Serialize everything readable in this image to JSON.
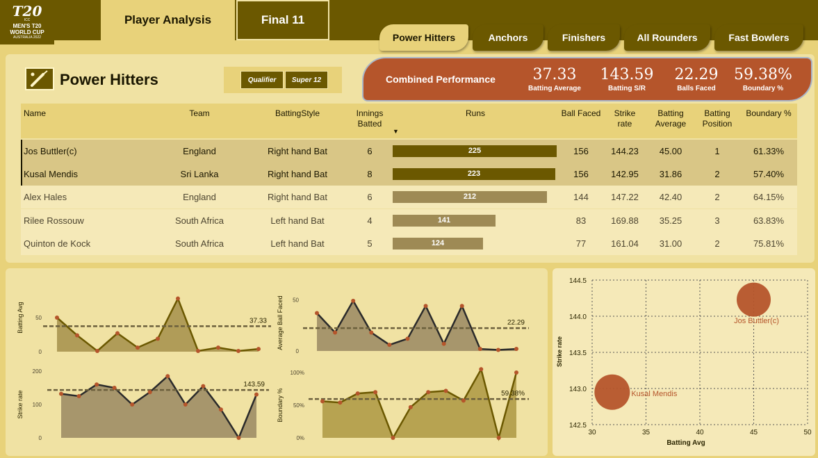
{
  "logo": {
    "line0": "ICC",
    "line1": "MEN'S T20",
    "line2": "WORLD CUP",
    "line3": "AUSTRALIA 2022"
  },
  "nav": {
    "player_analysis": "Player Analysis",
    "final11": "Final 11"
  },
  "tabs": [
    "Power Hitters",
    "Anchors",
    "Finishers",
    "All Rounders",
    "Fast Bowlers"
  ],
  "page_title": "Power Hitters",
  "stage_filters": [
    "Qualifier",
    "Super 12"
  ],
  "combined": {
    "label": "Combined Performance",
    "kpis": [
      {
        "value": "37.33",
        "label": "Batting Average"
      },
      {
        "value": "143.59",
        "label": "Batting S/R"
      },
      {
        "value": "22.29",
        "label": "Balls Faced"
      },
      {
        "value": "59.38%",
        "label": "Boundary %"
      }
    ]
  },
  "table": {
    "headers": [
      "Name",
      "Team",
      "BattingStyle",
      "Innings Batted",
      "Runs",
      "Ball Faced",
      "Strike rate",
      "Batting Average",
      "Batting Position",
      "Boundary %"
    ],
    "runs_max": 225,
    "rows": [
      {
        "name": "Jos Buttler(c)",
        "team": "England",
        "style": "Right hand Bat",
        "innings": "6",
        "runs": 225,
        "balls": "156",
        "sr": "144.23",
        "avg": "45.00",
        "pos": "1",
        "boundary": "61.33%",
        "selected": true
      },
      {
        "name": "Kusal Mendis",
        "team": "Sri Lanka",
        "style": "Right hand Bat",
        "innings": "8",
        "runs": 223,
        "balls": "156",
        "sr": "142.95",
        "avg": "31.86",
        "pos": "2",
        "boundary": "57.40%",
        "selected": true
      },
      {
        "name": "Alex Hales",
        "team": "England",
        "style": "Right hand Bat",
        "innings": "6",
        "runs": 212,
        "balls": "144",
        "sr": "147.22",
        "avg": "42.40",
        "pos": "2",
        "boundary": "64.15%",
        "selected": false
      },
      {
        "name": "Rilee Rossouw",
        "team": "South Africa",
        "style": "Left hand Bat",
        "innings": "4",
        "runs": 141,
        "balls": "83",
        "sr": "169.88",
        "avg": "35.25",
        "pos": "3",
        "boundary": "63.83%",
        "selected": false
      },
      {
        "name": "Quinton de Kock",
        "team": "South Africa",
        "style": "Left hand Bat",
        "innings": "5",
        "runs": 124,
        "balls": "77",
        "sr": "161.04",
        "avg": "31.00",
        "pos": "2",
        "boundary": "75.81%",
        "selected": false
      }
    ]
  },
  "colors": {
    "dark": "#6b5800",
    "accent": "#b5552b",
    "panel": "#f0e2a3",
    "bg": "#e8d27a"
  },
  "chart_data": [
    {
      "type": "area",
      "ylabel": "Batting Avg",
      "yticks": [
        "0",
        "50"
      ],
      "ylim": [
        0,
        100
      ],
      "values": [
        50,
        24,
        1,
        27,
        6,
        19,
        78,
        1,
        6,
        1,
        4
      ],
      "reference": 37.33,
      "reference_label": "37.33"
    },
    {
      "type": "area",
      "ylabel": "Average Ball Faced",
      "yticks": [
        "0",
        "50"
      ],
      "ylim": [
        0,
        55
      ],
      "values": [
        37,
        18,
        49,
        18,
        6,
        12,
        44,
        7,
        44,
        2,
        1,
        2
      ],
      "reference": 22.29,
      "reference_label": "22.29"
    },
    {
      "type": "area",
      "ylabel": "Strike rate",
      "yticks": [
        "0",
        "100",
        "200"
      ],
      "ylim": [
        0,
        200
      ],
      "values": [
        132,
        125,
        160,
        150,
        100,
        137,
        185,
        100,
        155,
        85,
        0,
        130
      ],
      "reference": 143.59,
      "reference_label": "143.59"
    },
    {
      "type": "area",
      "ylabel": "Boundary %",
      "yticks": [
        "0%",
        "50%",
        "100%"
      ],
      "ylim": [
        0,
        100
      ],
      "values": [
        56,
        54,
        68,
        70,
        0,
        47,
        70,
        72,
        57,
        105,
        0,
        100
      ],
      "reference": 59.38,
      "reference_label": "59.38%"
    },
    {
      "type": "scatter",
      "xlabel": "Batting Avg",
      "ylabel": "Strike rate",
      "xlim": [
        30,
        50
      ],
      "ylim": [
        142.5,
        144.5
      ],
      "xticks": [
        "30",
        "35",
        "40",
        "45",
        "50"
      ],
      "yticks": [
        "142.5",
        "143.0",
        "143.5",
        "144.0",
        "144.5"
      ],
      "points": [
        {
          "label": "Jos Buttler(c)",
          "x": 45.0,
          "y": 144.23,
          "size": 0.45
        },
        {
          "label": "Kusal Mendis",
          "x": 31.86,
          "y": 142.95,
          "size": 0.55
        }
      ]
    }
  ]
}
